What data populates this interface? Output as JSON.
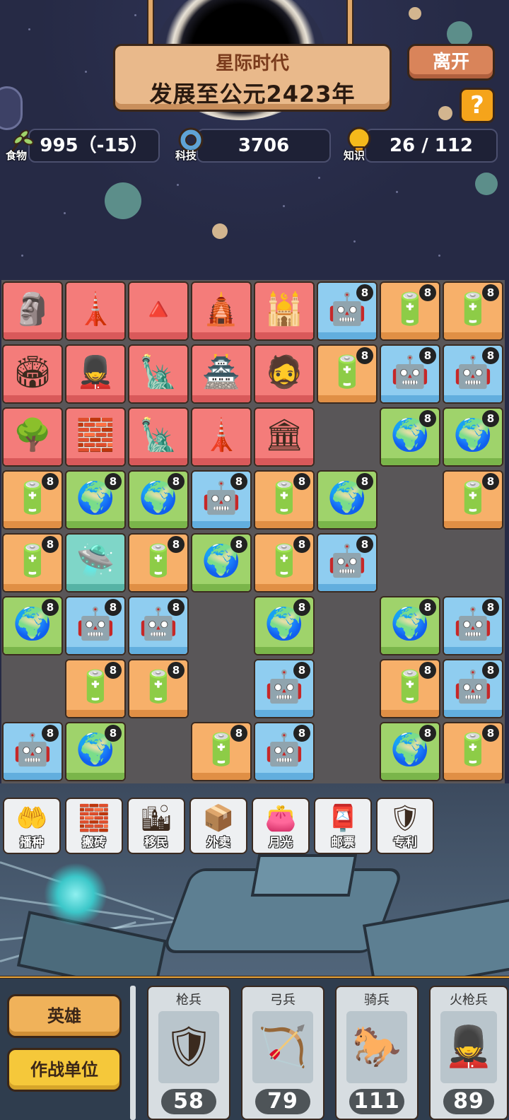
{
  "header": {
    "era_title": "星际时代",
    "era_subtitle": "发展至公元2423年",
    "leave_label": "离开",
    "help_label": "?"
  },
  "resources": {
    "food": {
      "label": "食物",
      "value": "995（-15）",
      "icon": "wheat-icon"
    },
    "tech": {
      "label": "科技",
      "value": "3706",
      "icon": "gear-icon"
    },
    "knowledge": {
      "label": "知识",
      "value": "26 / 112",
      "icon": "lightbulb-icon"
    }
  },
  "colors": {
    "red_tile": "#f47c7a",
    "blue_tile": "#8fcdf0",
    "orange_tile": "#f7b06a",
    "green_tile": "#9fd36b",
    "teal_tile": "#7fd6c8",
    "button_gold": "#f0b25a",
    "leave_button": "#d9845a",
    "help_button": "#f5a41b"
  },
  "board": {
    "rows": [
      [
        {
          "t": "red",
          "i": "stonehenge-icon",
          "g": "🗿"
        },
        {
          "t": "red",
          "i": "leaning-tower-icon",
          "g": "🗼"
        },
        {
          "t": "red",
          "i": "pyramid-icon",
          "g": "🔺"
        },
        {
          "t": "red",
          "i": "mayan-pyramid-icon",
          "g": "🛕"
        },
        {
          "t": "red",
          "i": "angkor-wat-icon",
          "g": "🕌"
        },
        {
          "t": "blue",
          "i": "mech-warrior-icon",
          "g": "🤖",
          "l": "8"
        },
        {
          "t": "orange",
          "i": "battery-icon",
          "g": "🔋",
          "l": "8"
        },
        {
          "t": "orange",
          "i": "battery-icon",
          "g": "🔋",
          "l": "8"
        }
      ],
      [
        {
          "t": "red",
          "i": "colosseum-icon",
          "g": "🏟"
        },
        {
          "t": "red",
          "i": "terracotta-army-icon",
          "g": "💂"
        },
        {
          "t": "red",
          "i": "greek-statue-icon",
          "g": "🗽"
        },
        {
          "t": "red",
          "i": "forbidden-city-icon",
          "g": "🏯"
        },
        {
          "t": "red",
          "i": "zeus-statue-icon",
          "g": "🧔"
        },
        {
          "t": "orange",
          "i": "battery-icon",
          "g": "🔋",
          "l": "8"
        },
        {
          "t": "blue",
          "i": "mech-warrior-icon",
          "g": "🤖",
          "l": "8"
        },
        {
          "t": "blue",
          "i": "mech-warrior-icon",
          "g": "🤖",
          "l": "8"
        }
      ],
      [
        {
          "t": "red",
          "i": "hanging-gardens-icon",
          "g": "🌳"
        },
        {
          "t": "red",
          "i": "great-wall-icon",
          "g": "🧱"
        },
        {
          "t": "red",
          "i": "statue-of-liberty-icon",
          "g": "🗽"
        },
        {
          "t": "red",
          "i": "lighthouse-icon",
          "g": "🗼"
        },
        {
          "t": "red",
          "i": "ancient-tower-icon",
          "g": "🏛"
        },
        {
          "t": "empty"
        },
        {
          "t": "green",
          "i": "green-planet-icon",
          "g": "🌍",
          "l": "8"
        },
        {
          "t": "green",
          "i": "green-planet-icon",
          "g": "🌍",
          "l": "8"
        }
      ],
      [
        {
          "t": "orange",
          "i": "battery-icon",
          "g": "🔋",
          "l": "8"
        },
        {
          "t": "green",
          "i": "green-planet-icon",
          "g": "🌍",
          "l": "8"
        },
        {
          "t": "green",
          "i": "green-planet-icon",
          "g": "🌍",
          "l": "8"
        },
        {
          "t": "blue",
          "i": "mech-warrior-icon",
          "g": "🤖",
          "l": "8"
        },
        {
          "t": "orange",
          "i": "battery-icon",
          "g": "🔋",
          "l": "8"
        },
        {
          "t": "green",
          "i": "green-planet-icon",
          "g": "🌍",
          "l": "8"
        },
        {
          "t": "empty"
        },
        {
          "t": "orange",
          "i": "battery-icon",
          "g": "🔋",
          "l": "8"
        }
      ],
      [
        {
          "t": "orange",
          "i": "battery-icon",
          "g": "🔋",
          "l": "8"
        },
        {
          "t": "teal",
          "i": "hologram-device-icon",
          "g": "🛸"
        },
        {
          "t": "orange",
          "i": "battery-icon",
          "g": "🔋",
          "l": "8"
        },
        {
          "t": "green",
          "i": "green-planet-icon",
          "g": "🌍",
          "l": "8"
        },
        {
          "t": "orange",
          "i": "battery-icon",
          "g": "🔋",
          "l": "8"
        },
        {
          "t": "blue",
          "i": "mech-warrior-icon",
          "g": "🤖",
          "l": "8"
        },
        {
          "t": "empty"
        },
        {
          "t": "empty"
        }
      ],
      [
        {
          "t": "green",
          "i": "green-planet-icon",
          "g": "🌍",
          "l": "8"
        },
        {
          "t": "blue",
          "i": "mech-warrior-icon",
          "g": "🤖",
          "l": "8"
        },
        {
          "t": "blue",
          "i": "mech-warrior-icon",
          "g": "🤖",
          "l": "8"
        },
        {
          "t": "empty"
        },
        {
          "t": "green",
          "i": "green-planet-icon",
          "g": "🌍",
          "l": "8"
        },
        {
          "t": "empty"
        },
        {
          "t": "green",
          "i": "green-planet-icon",
          "g": "🌍",
          "l": "8"
        },
        {
          "t": "blue",
          "i": "mech-warrior-icon",
          "g": "🤖",
          "l": "8"
        }
      ],
      [
        {
          "t": "empty"
        },
        {
          "t": "orange",
          "i": "battery-icon",
          "g": "🔋",
          "l": "8"
        },
        {
          "t": "orange",
          "i": "battery-icon",
          "g": "🔋",
          "l": "8"
        },
        {
          "t": "empty"
        },
        {
          "t": "blue",
          "i": "mech-warrior-icon",
          "g": "🤖",
          "l": "8"
        },
        {
          "t": "empty"
        },
        {
          "t": "orange",
          "i": "battery-icon",
          "g": "🔋",
          "l": "8"
        },
        {
          "t": "blue",
          "i": "mech-warrior-icon",
          "g": "🤖",
          "l": "8"
        }
      ],
      [
        {
          "t": "blue",
          "i": "mech-warrior-icon",
          "g": "🤖",
          "l": "8"
        },
        {
          "t": "green",
          "i": "green-planet-icon",
          "g": "🌍",
          "l": "8"
        },
        {
          "t": "empty"
        },
        {
          "t": "orange",
          "i": "battery-icon",
          "g": "🔋",
          "l": "8"
        },
        {
          "t": "blue",
          "i": "mech-warrior-icon",
          "g": "🤖",
          "l": "8"
        },
        {
          "t": "empty"
        },
        {
          "t": "green",
          "i": "green-planet-icon",
          "g": "🌍",
          "l": "8"
        },
        {
          "t": "orange",
          "i": "battery-icon",
          "g": "🔋",
          "l": "8"
        }
      ]
    ]
  },
  "actions": [
    {
      "label": "播种",
      "icon": "sowing-hand-icon",
      "glyph": "🤲"
    },
    {
      "label": "搬砖",
      "icon": "bricks-icon",
      "glyph": "🧱"
    },
    {
      "label": "移民",
      "icon": "city-dome-icon",
      "glyph": "🏙"
    },
    {
      "label": "外卖",
      "icon": "delivery-box-icon",
      "glyph": "📦"
    },
    {
      "label": "月光",
      "icon": "empty-wallet-icon",
      "glyph": "👛"
    },
    {
      "label": "邮票",
      "icon": "stamp-icon",
      "glyph": "📮"
    },
    {
      "label": "专利",
      "icon": "patent-shield-icon",
      "glyph": "🛡"
    }
  ],
  "tabs": {
    "heroes_label": "英雄",
    "combat_units_label": "作战单位"
  },
  "units": [
    {
      "name": "枪兵",
      "count": "58",
      "icon": "spearman-icon",
      "glyph": "🛡",
      "weapon": "spear-icon"
    },
    {
      "name": "弓兵",
      "count": "79",
      "icon": "archer-icon",
      "glyph": "🏹",
      "weapon": "bow-icon"
    },
    {
      "name": "骑兵",
      "count": "111",
      "icon": "cavalry-icon",
      "glyph": "🐎",
      "weapon": "horse-icon"
    },
    {
      "name": "火枪兵",
      "count": "89",
      "icon": "musketeer-icon",
      "glyph": "💂",
      "weapon": "musket-icon"
    }
  ]
}
